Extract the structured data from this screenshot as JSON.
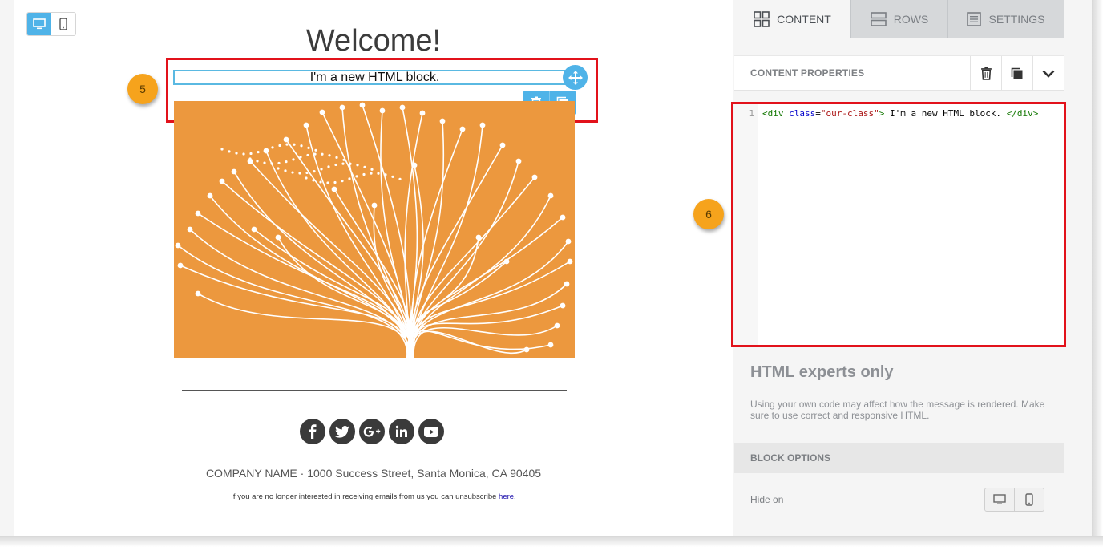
{
  "canvas": {
    "title": "Welcome!",
    "html_block_text": "I'm a new HTML block.",
    "company_line": "COMPANY NAME · 1000 Success Street, Santa Monica, CA 90405",
    "unsubscribe_text": "If you are no longer interested in receiving emails from us you can unsubscribe",
    "unsubscribe_link": "here",
    "unsubscribe_end": ".",
    "view_modes": [
      "desktop-icon",
      "mobile-icon"
    ],
    "social_icons": [
      "facebook-icon",
      "twitter-icon",
      "google-plus-icon",
      "linkedin-icon",
      "youtube-icon"
    ]
  },
  "annotations": {
    "badge_5": "5",
    "badge_6": "6",
    "highlight_color": "#e2121b",
    "badge_color": "#f6a31c"
  },
  "sidebar": {
    "tabs": [
      {
        "label": "CONTENT",
        "icon": "grid-icon",
        "active": true
      },
      {
        "label": "ROWS",
        "icon": "rows-icon",
        "active": false
      },
      {
        "label": "SETTINGS",
        "icon": "settings-icon",
        "active": false
      }
    ],
    "content_properties_title": "CONTENT PROPERTIES",
    "code_line_number": "1",
    "code_text": "<div class=\"our-class\"> I'm a new HTML block. </div>",
    "code_tokens": {
      "t1": "<div ",
      "t2": "class",
      "t3": "=",
      "t4": "\"our-class\"",
      "t5": ">",
      "t6": " I'm a new HTML block. ",
      "t7": "</div>"
    },
    "help_title": "HTML experts only",
    "help_text": "Using your own code may affect how the message is rendered. Make sure to use correct and responsive HTML.",
    "block_options_title": "BLOCK OPTIONS",
    "hide_on_label": "Hide on"
  },
  "colors": {
    "accent": "#4fb3e8",
    "hero_background": "#ec983e"
  }
}
